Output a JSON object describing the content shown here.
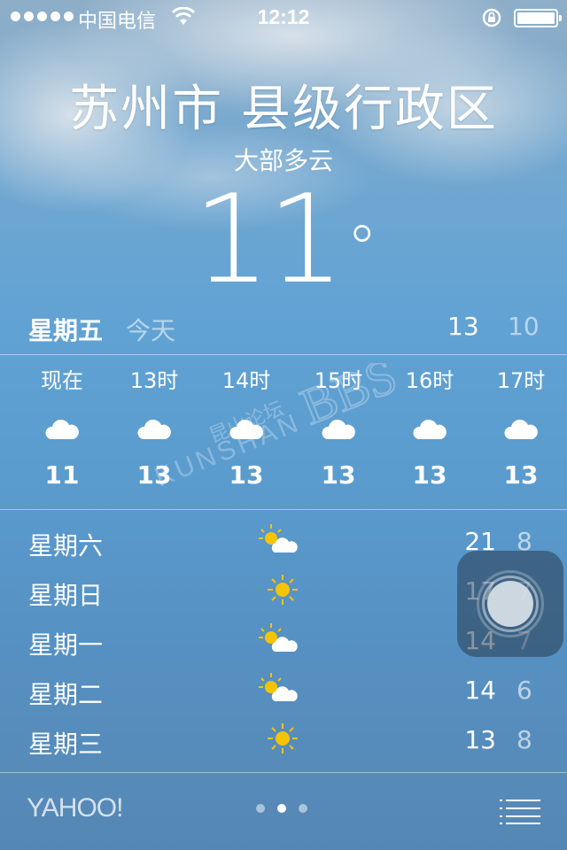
{
  "status_bar": {
    "carrier": "中国电信",
    "time": "12:12",
    "icons": [
      "signal-dots",
      "wifi-icon",
      "rotation-lock-icon",
      "battery-icon"
    ]
  },
  "location": {
    "city": "苏州市 县级行政区",
    "condition": "大部多云",
    "temperature": "11",
    "degree_symbol": "°"
  },
  "today": {
    "day": "星期五",
    "label": "今天",
    "high": "13",
    "low": "10"
  },
  "hourly": [
    {
      "time": "现在",
      "icon": "cloud-icon",
      "temp": "11"
    },
    {
      "time": "13时",
      "icon": "cloud-icon",
      "temp": "13"
    },
    {
      "time": "14时",
      "icon": "cloud-icon",
      "temp": "13"
    },
    {
      "time": "15时",
      "icon": "cloud-icon",
      "temp": "13"
    },
    {
      "time": "16时",
      "icon": "cloud-icon",
      "temp": "13"
    },
    {
      "time": "17时",
      "icon": "cloud-icon",
      "temp": "13"
    }
  ],
  "watermark": {
    "line1": "昆山论坛",
    "line2": "KUNSHAN",
    "line3": "BBS"
  },
  "forecast": [
    {
      "day": "星期六",
      "icon": "partly-sunny-icon",
      "high": "21",
      "low": "8"
    },
    {
      "day": "星期日",
      "icon": "sun-icon",
      "high": "17",
      "low": "7"
    },
    {
      "day": "星期一",
      "icon": "partly-sunny-icon",
      "high": "14",
      "low": "7"
    },
    {
      "day": "星期二",
      "icon": "partly-sunny-icon",
      "high": "14",
      "low": "6"
    },
    {
      "day": "星期三",
      "icon": "sun-icon",
      "high": "13",
      "low": "8"
    }
  ],
  "footer": {
    "brand": "YAHOO!",
    "page_count": 3,
    "active_page": 2
  },
  "colors": {
    "text": "#ffffff",
    "sun": "#f5c400",
    "sky_top": "#8eaec8",
    "sky_bottom": "#5687b4"
  }
}
